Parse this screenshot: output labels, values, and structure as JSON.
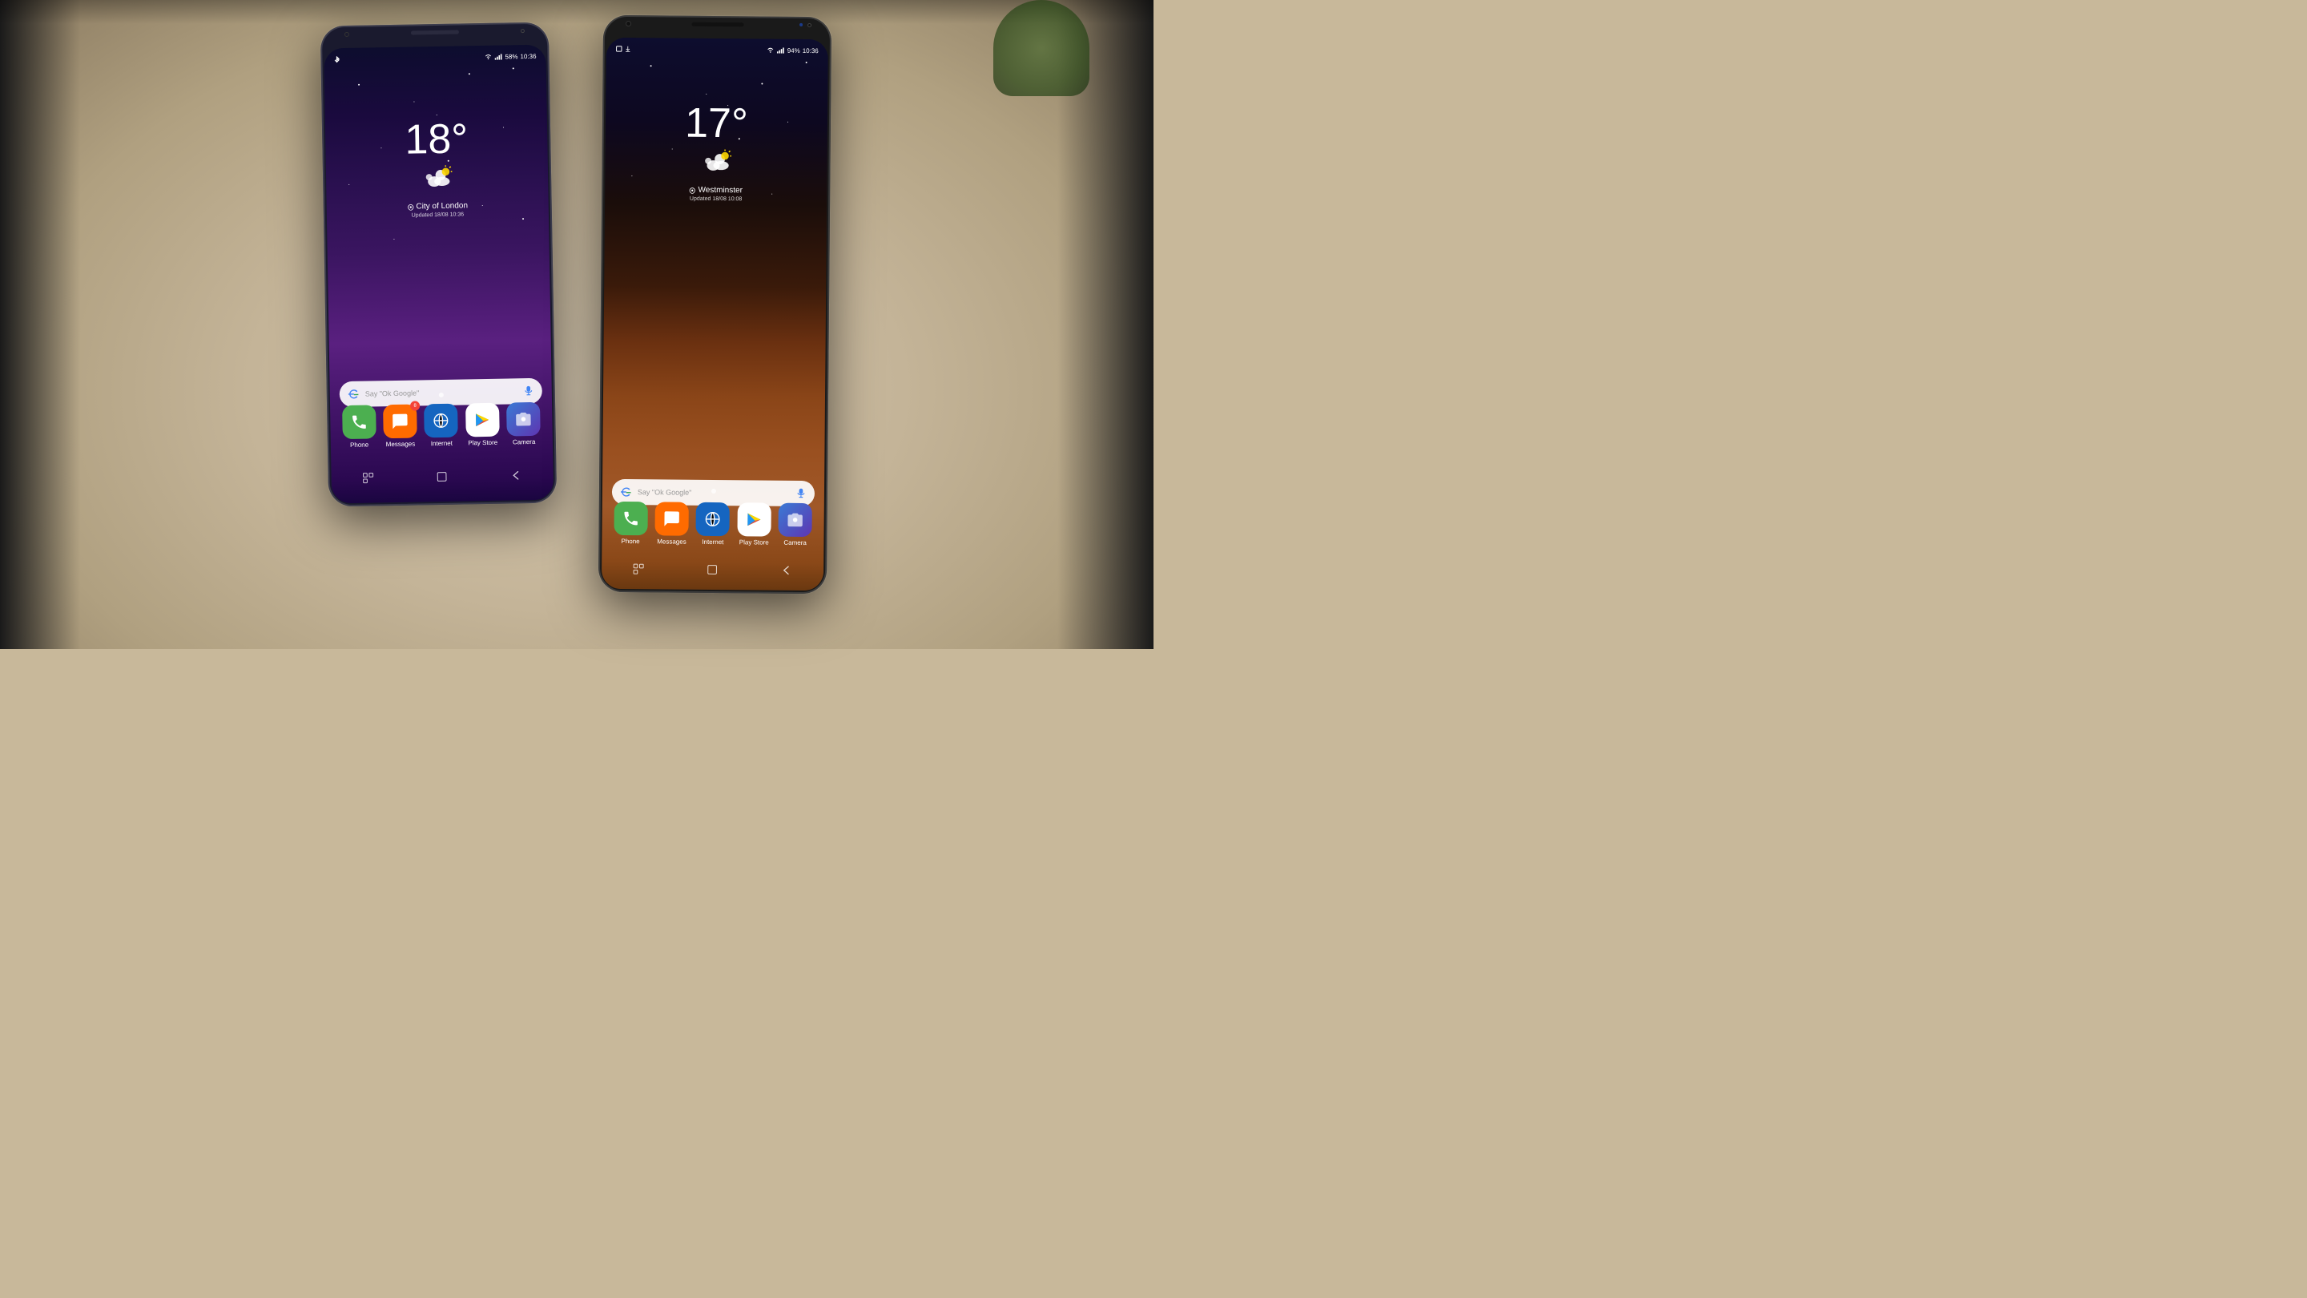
{
  "scene": {
    "bg_color": "#c4b090"
  },
  "phone_left": {
    "status_bar": {
      "left_icons": [
        "bluetooth",
        "signal"
      ],
      "battery": "58%",
      "time": "10:36",
      "wifi": true
    },
    "weather": {
      "temperature": "18°",
      "location": "City of London",
      "updated": "Updated 18/08 10:36"
    },
    "search": {
      "placeholder": "Say \"Ok Google\""
    },
    "apps": [
      {
        "name": "Phone",
        "color": "#4CAF50",
        "label": "Phone"
      },
      {
        "name": "Messages",
        "color": "#FF6B00",
        "label": "Messages",
        "badge": "8"
      },
      {
        "name": "Internet",
        "color": "#1565C0",
        "label": "Internet"
      },
      {
        "name": "Play Store",
        "color": "#ffffff",
        "label": "Play Store"
      },
      {
        "name": "Camera",
        "color": "#3a7bd5",
        "label": "Camera"
      }
    ],
    "nav": [
      "recent",
      "home",
      "back"
    ]
  },
  "phone_right": {
    "status_bar": {
      "left_icons": [
        "screenshot",
        "download"
      ],
      "battery": "94%",
      "time": "10:36",
      "wifi": true
    },
    "weather": {
      "temperature": "17°",
      "location": "Westminster",
      "updated": "Updated 18/08 10:08"
    },
    "search": {
      "placeholder": "Say \"Ok Google\""
    },
    "apps": [
      {
        "name": "Phone",
        "color": "#4CAF50",
        "label": "Phone"
      },
      {
        "name": "Messages",
        "color": "#FF6B00",
        "label": "Messages"
      },
      {
        "name": "Internet",
        "color": "#1565C0",
        "label": "Internet"
      },
      {
        "name": "Play Store",
        "color": "#ffffff",
        "label": "Play Store"
      },
      {
        "name": "Camera",
        "color": "#3a7bd5",
        "label": "Camera"
      }
    ],
    "nav": [
      "recent",
      "home",
      "back"
    ]
  }
}
